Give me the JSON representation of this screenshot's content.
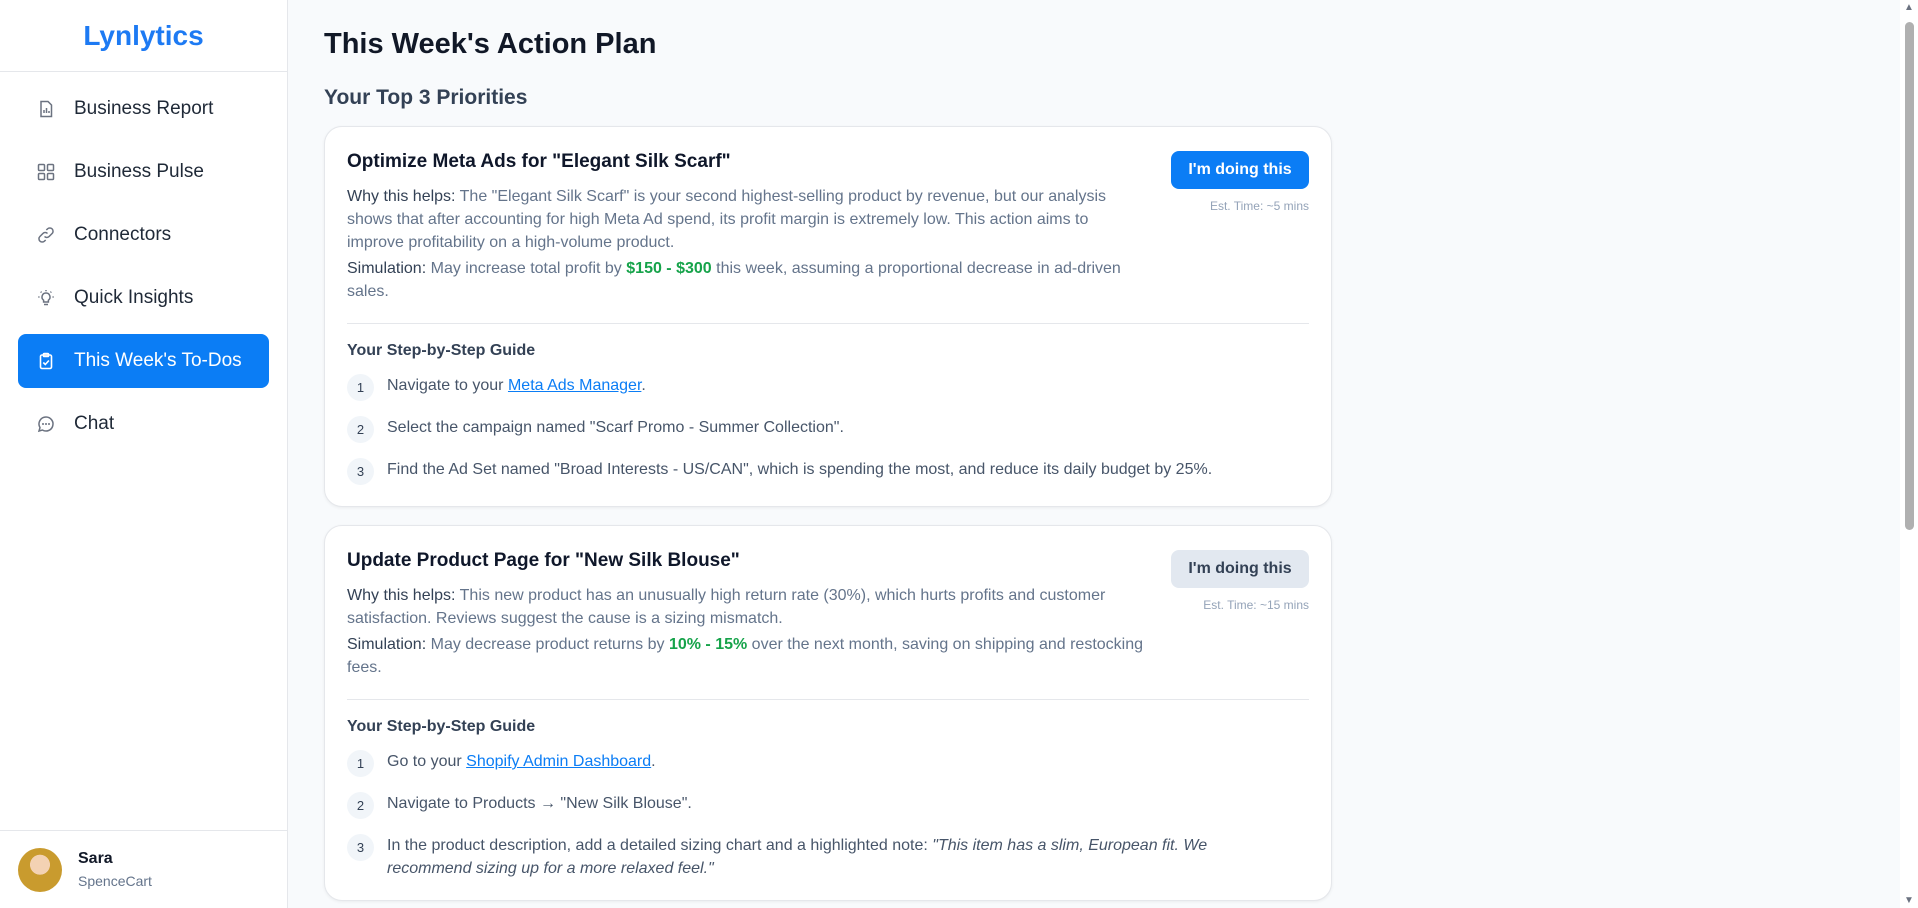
{
  "brand": "Lynlytics",
  "nav": [
    {
      "label": "Business Report",
      "icon": "report-icon",
      "active": false
    },
    {
      "label": "Business Pulse",
      "icon": "grid-icon",
      "active": false
    },
    {
      "label": "Connectors",
      "icon": "link-icon",
      "active": false
    },
    {
      "label": "Quick Insights",
      "icon": "lightbulb-icon",
      "active": false
    },
    {
      "label": "This Week's To-Dos",
      "icon": "clipboard-check-icon",
      "active": true
    },
    {
      "label": "Chat",
      "icon": "chat-icon",
      "active": false
    }
  ],
  "user": {
    "name": "Sara",
    "org": "SpenceCart"
  },
  "page": {
    "title": "This Week's Action Plan",
    "subtitle": "Your Top 3 Priorities"
  },
  "cards": [
    {
      "title": "Optimize Meta Ads for \"Elegant Silk Scarf\"",
      "why_label": "Why this helps:",
      "why_text": "The \"Elegant Silk Scarf\" is your second highest-selling product by revenue, but our analysis shows that after accounting for high Meta Ad spend, its profit margin is extremely low. This action aims to improve profitability on a high-volume product.",
      "sim_label": "Simulation:",
      "sim_before": "May increase total profit by",
      "sim_highlight": "$150 - $300",
      "sim_after": "this week, assuming a proportional decrease in ad-driven sales.",
      "button": "I'm doing this",
      "est": "Est. Time: ~5 mins",
      "guide_title": "Your Step-by-Step Guide",
      "steps": [
        {
          "num": "1",
          "before": "Navigate to your",
          "link": "Meta Ads Manager",
          "after": "."
        },
        {
          "num": "2",
          "before": "Select the campaign named \"Scarf Promo - Summer Collection\".",
          "link": "",
          "after": ""
        },
        {
          "num": "3",
          "before": "Find the Ad Set named \"Broad Interests - US/CAN\", which is spending the most, and reduce its daily budget by 25%.",
          "link": "",
          "after": ""
        }
      ]
    },
    {
      "title": "Update Product Page for \"New Silk Blouse\"",
      "why_label": "Why this helps:",
      "why_text": "This new product has an unusually high return rate (30%), which hurts profits and customer satisfaction. Reviews suggest the cause is a sizing mismatch.",
      "sim_label": "Simulation:",
      "sim_before": "May decrease product returns by",
      "sim_highlight": "10% - 15%",
      "sim_after": "over the next month, saving on shipping and restocking fees.",
      "button": "I'm doing this",
      "est": "Est. Time: ~15 mins",
      "guide_title": "Your Step-by-Step Guide",
      "steps": [
        {
          "num": "1",
          "before": "Go to your",
          "link": "Shopify Admin Dashboard",
          "after": "."
        },
        {
          "num": "2",
          "before": "Navigate to Products → \"New Silk Blouse\".",
          "link": "",
          "after": ""
        },
        {
          "num": "3",
          "before": "In the product description, add a detailed sizing chart and a highlighted note:",
          "link": "",
          "after": "",
          "quote": "\"This item has a slim, European fit. We recommend sizing up for a more relaxed feel.\""
        }
      ]
    }
  ]
}
